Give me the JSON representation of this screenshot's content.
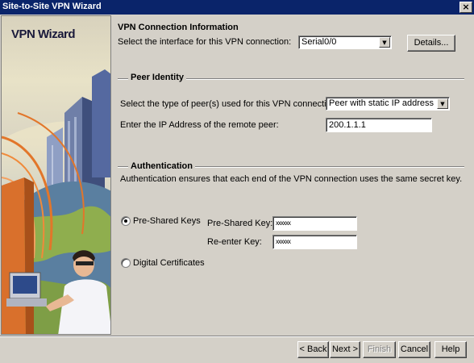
{
  "window": {
    "title": "Site-to-Site VPN Wizard",
    "close_symbol": "×"
  },
  "banner": {
    "title": "VPN Wizard"
  },
  "connection": {
    "heading": "VPN Connection Information",
    "interface_label": "Select the interface for this VPN connection:",
    "interface_value": "Serial0/0",
    "details_button": "Details..."
  },
  "peer": {
    "heading": "Peer Identity",
    "type_label": "Select the type of peer(s) used for this VPN connection:",
    "type_value": "Peer with static IP address",
    "ip_label": "Enter the IP Address of the remote peer:",
    "ip_value": "200.1.1.1"
  },
  "auth": {
    "heading": "Authentication",
    "description": "Authentication ensures that each end of the VPN connection uses the same secret key.",
    "psk_radio_label": "Pre-Shared Keys",
    "psk_label": "Pre-Shared Key:",
    "psk_value": "xxxxxx",
    "reenter_label": "Re-enter Key:",
    "reenter_value": "xxxxxx",
    "cert_radio_label": "Digital Certificates",
    "selected": "Pre-Shared Keys"
  },
  "footer": {
    "back": "< Back",
    "next": "Next >",
    "finish": "Finish",
    "cancel": "Cancel",
    "help": "Help"
  }
}
